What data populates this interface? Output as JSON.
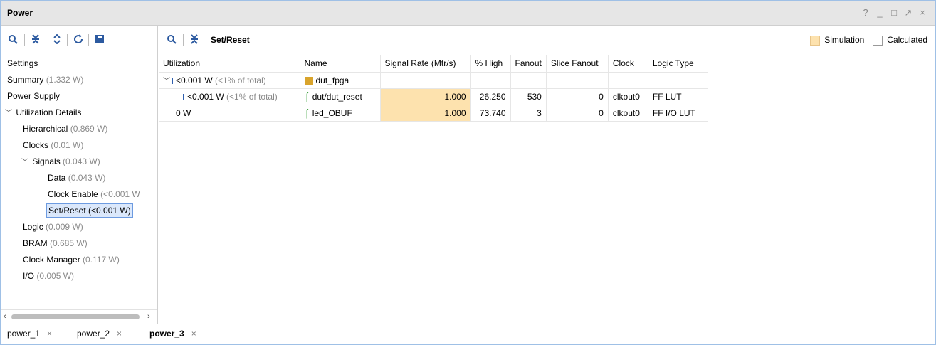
{
  "window": {
    "title": "Power",
    "controls": [
      "?",
      "_",
      "□",
      "↗",
      "×"
    ]
  },
  "left_toolbar": [
    "search-icon",
    "collapse-all-icon",
    "expand-all-icon",
    "refresh-icon",
    "save-icon"
  ],
  "tree": [
    {
      "label": "Settings",
      "value": ""
    },
    {
      "label": "Summary",
      "value": "(1.332 W)"
    },
    {
      "label": "Power Supply",
      "value": ""
    },
    {
      "label": "Utilization Details",
      "value": ""
    },
    {
      "label": "Hierarchical",
      "value": "(0.869 W)"
    },
    {
      "label": "Clocks",
      "value": "(0.01 W)"
    },
    {
      "label": "Signals",
      "value": "(0.043 W)"
    },
    {
      "label": "Data",
      "value": "(0.043 W)"
    },
    {
      "label": "Clock Enable",
      "value": "(<0.001 W"
    },
    {
      "label": "Set/Reset",
      "value": "(<0.001 W)"
    },
    {
      "label": "Logic",
      "value": "(0.009 W)"
    },
    {
      "label": "BRAM",
      "value": "(0.685 W)"
    },
    {
      "label": "Clock Manager",
      "value": "(0.117 W)"
    },
    {
      "label": "I/O",
      "value": "(0.005 W)"
    }
  ],
  "right_toolbar": {
    "title": "Set/Reset",
    "legend": {
      "simulation": "Simulation",
      "calculated": "Calculated"
    }
  },
  "table": {
    "headers": [
      "Utilization",
      "Name",
      "Signal Rate (Mtr/s)",
      "% High",
      "Fanout",
      "Slice Fanout",
      "Clock",
      "Logic Type"
    ],
    "rows": [
      {
        "util": "<0.001 W",
        "util_note": "(<1% of total)",
        "name": "dut_fpga",
        "rate": "",
        "high": "",
        "fanout": "",
        "slice_fanout": "",
        "clock": "",
        "logic": ""
      },
      {
        "util": "<0.001 W",
        "util_note": "(<1% of total)",
        "name": "dut/dut_reset",
        "rate": "1.000",
        "high": "26.250",
        "fanout": "530",
        "slice_fanout": "0",
        "clock": "clkout0",
        "logic": "FF LUT"
      },
      {
        "util": "0 W",
        "util_note": "",
        "name": "led_OBUF",
        "rate": "1.000",
        "high": "73.740",
        "fanout": "3",
        "slice_fanout": "0",
        "clock": "clkout0",
        "logic": "FF I/O LUT"
      }
    ]
  },
  "tabs": [
    {
      "label": "power_1",
      "close": "×"
    },
    {
      "label": "power_2",
      "close": "×"
    },
    {
      "label": "power_3",
      "close": "×"
    }
  ],
  "colors": {
    "simulation": "#fde2ae",
    "accent": "#2c5aa0",
    "selection": "#dbe8fb"
  }
}
